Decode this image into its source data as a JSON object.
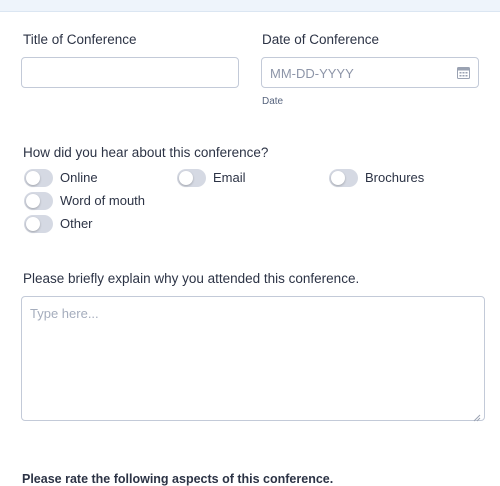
{
  "form": {
    "title_label": "Title of Conference",
    "title_value": "",
    "date_label": "Date of Conference",
    "date_placeholder": "MM-DD-YYYY",
    "date_sublabel": "Date",
    "date_icon": "calendar-icon",
    "heard_question": "How did you hear about this conference?",
    "heard_options": [
      {
        "label": "Online",
        "checked": false
      },
      {
        "label": "Email",
        "checked": false
      },
      {
        "label": "Brochures",
        "checked": false
      },
      {
        "label": "Word of mouth",
        "checked": false
      },
      {
        "label": "Other",
        "checked": false
      }
    ],
    "explain_question": "Please briefly explain why you attended this conference.",
    "explain_placeholder": "Type here...",
    "rate_heading": "Please rate the following aspects of this conference."
  },
  "colors": {
    "toggle_off": "#d5d9e3",
    "border": "#c3cad8",
    "text": "#2c3345"
  }
}
